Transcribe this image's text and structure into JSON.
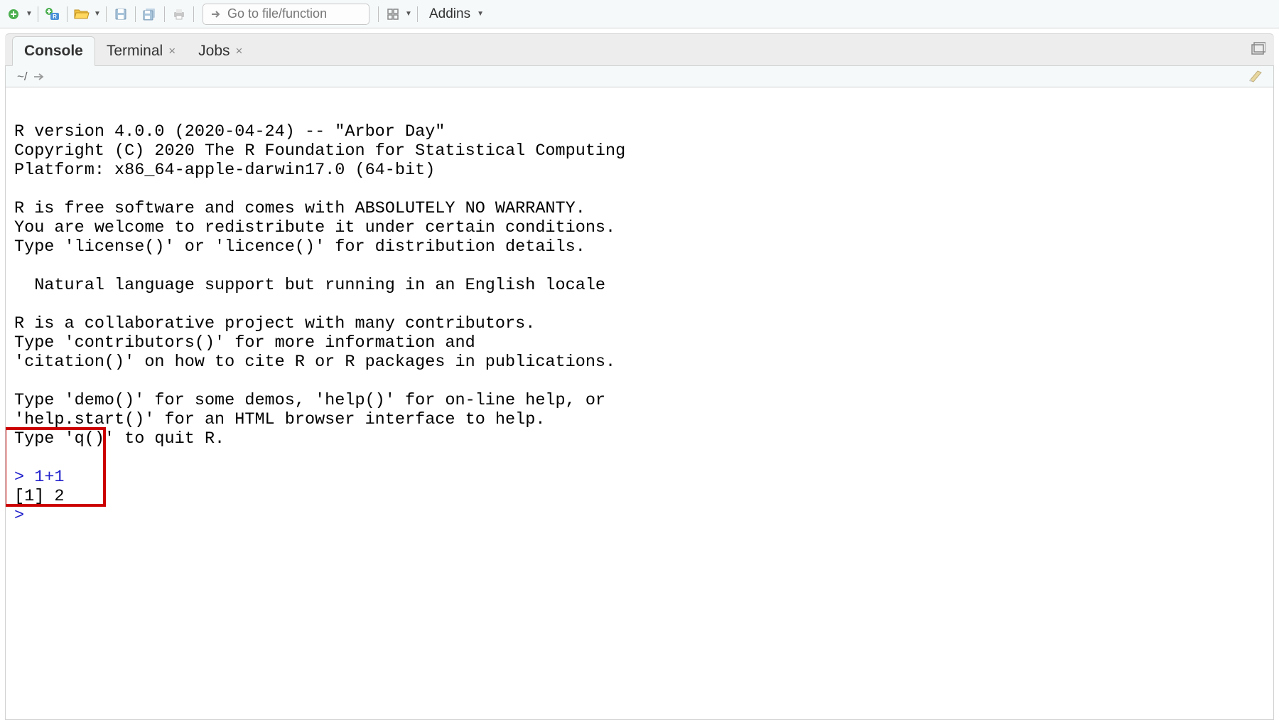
{
  "toolbar": {
    "goto_placeholder": "Go to file/function",
    "addins_label": "Addins"
  },
  "tabs": {
    "console": "Console",
    "terminal": "Terminal",
    "jobs": "Jobs"
  },
  "path_bar": {
    "path": "~/"
  },
  "console": {
    "banner": "R version 4.0.0 (2020-04-24) -- \"Arbor Day\"\nCopyright (C) 2020 The R Foundation for Statistical Computing\nPlatform: x86_64-apple-darwin17.0 (64-bit)\n\nR is free software and comes with ABSOLUTELY NO WARRANTY.\nYou are welcome to redistribute it under certain conditions.\nType 'license()' or 'licence()' for distribution details.\n\n  Natural language support but running in an English locale\n\nR is a collaborative project with many contributors.\nType 'contributors()' for more information and\n'citation()' on how to cite R or R packages in publications.\n\nType 'demo()' for some demos, 'help()' for on-line help, or\n'help.start()' for an HTML browser interface to help.\nType 'q()' to quit R.\n",
    "prompt1": "> ",
    "input1": "1+1",
    "output1": "[1] 2",
    "prompt2": "> "
  }
}
